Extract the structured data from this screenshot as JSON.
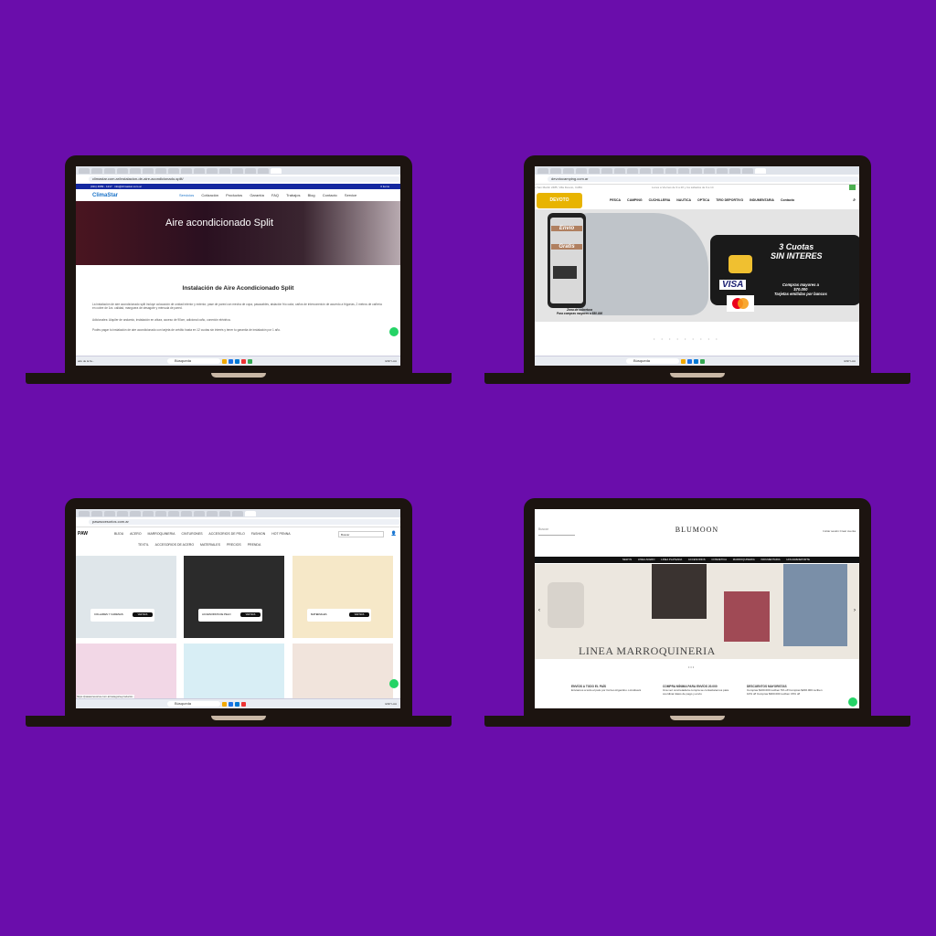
{
  "background_color": "#6a0dab",
  "laptops": [
    {
      "site": "climastar",
      "url": "climastar.com.ar/instalacion-de-aire-acondicionado-split/",
      "topbar": {
        "phone": "(011) 4689 - 1217",
        "email": "info@climastar.com.ar",
        "cart": "0 items"
      },
      "logo": "ClimaStar",
      "menu": [
        "Servicios",
        "Cotización",
        "Productos",
        "Garantía",
        "FAQ",
        "Trabajos",
        "Blog",
        "Contacto",
        "Service"
      ],
      "hero_title": "Aire acondicionado Split",
      "heading": "Instalación de Aire Acondicionado Split",
      "paragraphs": [
        "La instalación de aire acondicionado split incluye colocación de unidad interior y exterior, pase de pared con mecha de copa, pasacables, aislación frío calor, caños de interconexión de acuerdo a frigorías, 2 metros de cañería en cobre de 1ra. calidad, manguera de desagote y ménsula de pared.",
        "Adicionales: Alquiler de andamio, instalación en altura, acceso de 90cm, adicional caño, conexión eléctrica.",
        "Podés pagar tu instalación de aire acondicionado con tarjeta de crédito hasta en 12 cuotas sin interés y tener tu garantía de instalación por 1 año."
      ],
      "taskbar": {
        "search": "Búsqueda",
        "status": "ESP LAA"
      },
      "bottom_left": "ado de la fa..."
    },
    {
      "site": "devotocamping",
      "url": "devotocamping.com.ar",
      "top_note": "o San Martín 2485, Villa Devoto, CABA",
      "top_center": "Lunes a Viernes de 9 a 20 y los sábados de 9 a 14",
      "logo": "DEVOTO",
      "menu": [
        "PESCA",
        "CAMPING",
        "CUCHILLERIA",
        "NAUTICA",
        "OPTICA",
        "TIRO DEPORTIVO",
        "INDUMENTARIA",
        "Contacto"
      ],
      "banner": {
        "shipping_line1": "Envío",
        "shipping_line2": "Gratis",
        "coverage_line1": "Zona de cobertura",
        "coverage_line2": "Para compras mayores a $50.000",
        "card_title_line1": "3 Cuotas",
        "card_title_line2": "SIN INTERES",
        "card_sub_line1": "Compras mayores a",
        "card_sub_line2": "$70.000",
        "card_sub_line3": "Tarjetas emitidas por bancos",
        "visa": "VISA"
      },
      "taskbar": {
        "search": "Búsqueda",
        "status": "ESP LAA"
      }
    },
    {
      "site": "pawaccesorios",
      "url": "pawaccesorios.com.ar",
      "logo": "PAW",
      "menu_row1": [
        "BIJOU",
        "ACERO",
        "MARROQUINERIA",
        "CINTURONES",
        "ACCESORIOS DE PELO",
        "FASHION",
        "HOT PENNA"
      ],
      "menu_row2": [
        "TEXTIL",
        "ACCESORIOS DE ACERO",
        "MATERIALES",
        "PRECIOS",
        "PRENDA"
      ],
      "search_placeholder": "Buscar",
      "tiles": [
        {
          "label": "COLLARES Y CADENAS",
          "button": "VER MAS",
          "bg": "#dfe6ea"
        },
        {
          "label": "ACCESORIOS DE PELO",
          "button": "VER MAS",
          "bg": "#2b2b2b"
        },
        {
          "label": "MATERIALES",
          "button": "VER MAS",
          "bg": "#f6e8c8"
        },
        {
          "label": "",
          "button": "",
          "bg": "#f2d7e6"
        },
        {
          "label": "",
          "button": "",
          "bg": "#d8eef5"
        },
        {
          "label": "",
          "button": "",
          "bg": "#f1e4dc"
        }
      ],
      "status_url": "https://pawaccesorios.com.ar/categoria-producto/...",
      "taskbar": {
        "search": "Búsqueda",
        "status": "ESP LAA"
      }
    },
    {
      "site": "blumoon",
      "search_placeholder": "Buscar",
      "logo": "BLUMOON",
      "links": "Iniciar sesión  Crear cuenta",
      "menu": [
        "NEW IN",
        "LINEA ACERO",
        "LINEA PLATEADA",
        "ACCESORIOS",
        "COSMETICA",
        "MARROQUINERIA",
        "INDUMENTARIA",
        "HOGAR&DEPORTE"
      ],
      "hero_title": "LINEA MARROQUINERIA",
      "features": [
        {
          "title": "ENVÍOS A TODO EL PAÍS",
          "text": "Envíamos a todo el país por Correo Argentino o Andreani"
        },
        {
          "title": "COMPRA MÍNIMA PARA ENVÍOS 20.000",
          "text": "Una vez concretada la compra se contactaremos para coordinar datos de pago y envío"
        },
        {
          "title": "DESCUENTOS MAYORISTAS",
          "text": "Compras $100.000 reciben 5% off Compras $200.000 reciben 10% off Compras $300.000 reciben 15% off"
        }
      ]
    }
  ]
}
